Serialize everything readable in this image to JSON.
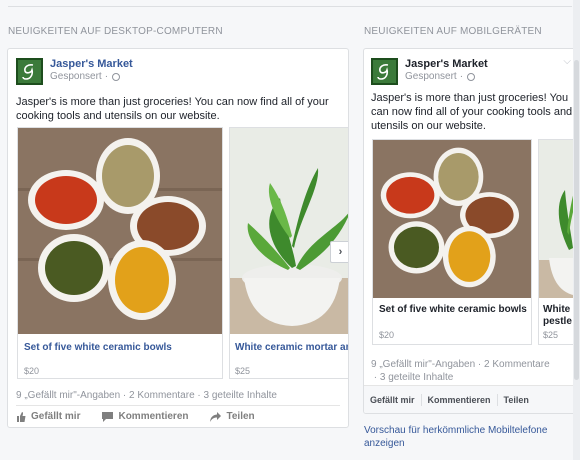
{
  "desktop": {
    "section_label": "Neuigkeiten auf Desktop-Computern",
    "page_name": "Jasper's Market",
    "sponsored": "Gesponsert",
    "body": "Jasper's is more than just groceries! You can now find all of your cooking tools and utensils on our website.",
    "slides": [
      {
        "title": "Set of five white ceramic bowls",
        "price": "$20"
      },
      {
        "title": "White ceramic mortar and pestle",
        "price": "$25"
      }
    ],
    "stats": {
      "likes": "9 „Gefällt mir\"-Angaben",
      "comments": "2 Kommentare",
      "shares": "3 geteilte Inhalte"
    },
    "actions": {
      "like": "Gefällt mir",
      "comment": "Kommentieren",
      "share": "Teilen"
    }
  },
  "mobile": {
    "section_label": "Neuigkeiten auf Mobilgeräten",
    "page_name": "Jasper's Market",
    "sponsored": "Gesponsert",
    "body": "Jasper's is more than just groceries! You can now find all of your cooking tools and utensils on our website.",
    "slides": [
      {
        "title": "Set of five white ceramic bowls",
        "price": "$20"
      },
      {
        "title": "White ceramic mortar and pestle",
        "price": "$25"
      }
    ],
    "stats": {
      "likes": "9 „Gefällt mir\"-Angaben",
      "comments": "2 Kommentare",
      "shares": "3 geteilte Inhalte"
    },
    "actions": {
      "like": "Gefällt mir",
      "comment": "Kommentieren",
      "share": "Teilen"
    },
    "legacy_link": "Vorschau für herkömmliche Mobiltelefone anzeigen"
  },
  "colors": {
    "link": "#365899",
    "muted": "#90949c",
    "logo_green": "#3b7a3a"
  }
}
